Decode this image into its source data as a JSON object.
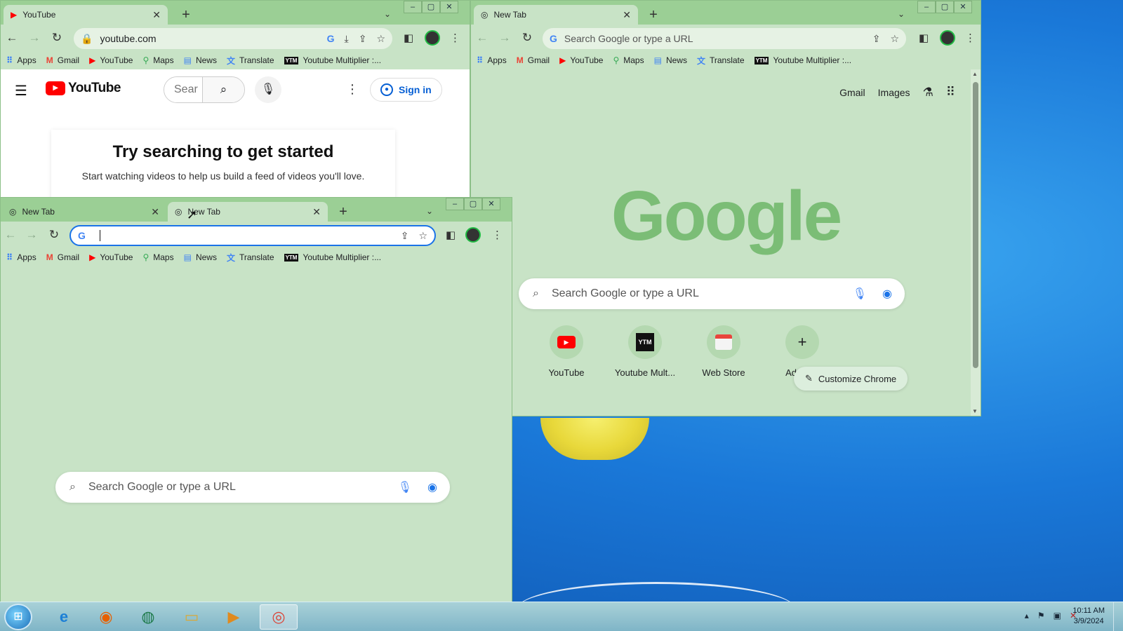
{
  "colors": {
    "chrome_frame": "#9bcf95",
    "page_bg": "#c8e3c6",
    "google_logo": "#7bbd76",
    "youtube_red": "#ff0000",
    "accent": "#1a73e8"
  },
  "bookmarks": [
    "Apps",
    "Gmail",
    "YouTube",
    "Maps",
    "News",
    "Translate",
    "Youtube Multiplier :..."
  ],
  "window_youtube": {
    "tab_title": "YouTube",
    "url": "youtube.com",
    "page": {
      "search_placeholder": "Sear",
      "sign_in": "Sign in",
      "heading": "Try searching to get started",
      "subtext": "Start watching videos to help us build a feed of videos you'll love."
    }
  },
  "window_newtab_right": {
    "tab_title": "New Tab",
    "omnibox_placeholder": "Search Google or type a URL",
    "page": {
      "links": [
        "Gmail",
        "Images"
      ],
      "logo": "Google",
      "search_placeholder": "Search Google or type a URL",
      "shortcuts": [
        "YouTube",
        "Youtube Mult...",
        "Web Store",
        "Add sho"
      ],
      "customize": "Customize Chrome"
    }
  },
  "window_newtab_front": {
    "tabs": [
      "New Tab",
      "New Tab"
    ],
    "omnibox_value": "",
    "page": {
      "search_placeholder": "Search Google or type a URL"
    }
  },
  "taskbar": {
    "apps": [
      "internet-explorer",
      "firefox",
      "app-globe",
      "file-explorer",
      "media-player",
      "chrome"
    ],
    "time": "10:11 AM",
    "date": "3/9/2024"
  }
}
